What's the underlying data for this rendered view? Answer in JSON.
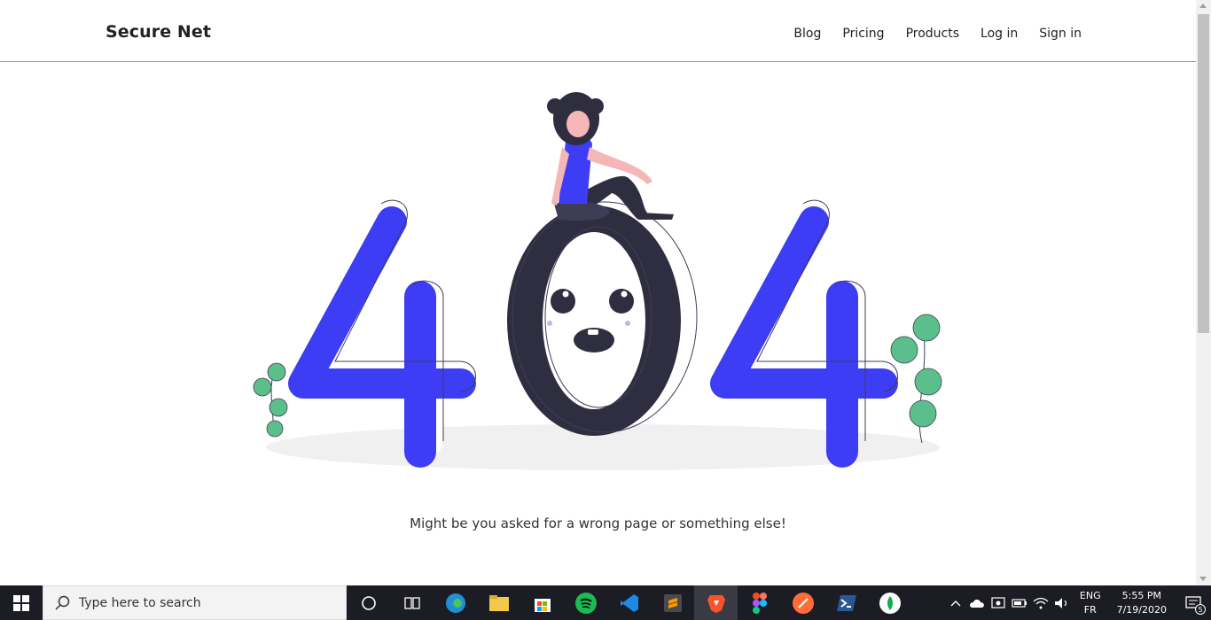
{
  "header": {
    "brand": "Secure Net",
    "nav": [
      "Blog",
      "Pricing",
      "Products",
      "Log in",
      "Sign in"
    ]
  },
  "error": {
    "code": "404",
    "message": "Might be you asked for a wrong page or something else!"
  },
  "colors": {
    "accent": "#3d3df5",
    "dark": "#2f2e41",
    "leaf": "#5bbf8c",
    "skin": "#f4b6b6",
    "taskbar": "#1c1c24"
  },
  "taskbar": {
    "search_placeholder": "Type here to search",
    "apps": [
      "cortana-icon",
      "task-view-icon",
      "edge-icon",
      "file-explorer-icon",
      "store-icon",
      "spotify-icon",
      "vscode-icon",
      "sublime-icon",
      "brave-icon",
      "figma-icon",
      "postman-icon",
      "powershell-icon",
      "mongodb-icon"
    ],
    "lang_primary": "ENG",
    "lang_secondary": "FR",
    "time": "5:55 PM",
    "date": "7/19/2020",
    "notification_count": "5"
  }
}
